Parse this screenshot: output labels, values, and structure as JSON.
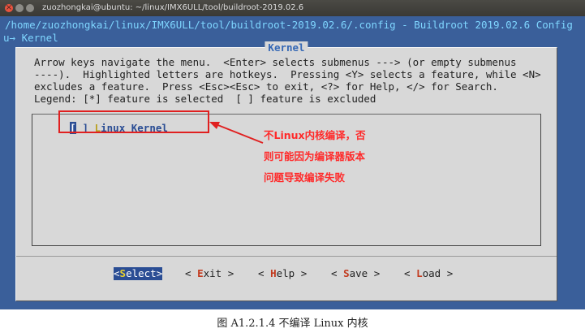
{
  "window": {
    "title": "zuozhongkai@ubuntu: ~/linux/IMX6ULL/tool/buildroot-2019.02.6"
  },
  "terminal": {
    "path_line": "/home/zuozhongkai/linux/IMX6ULL/tool/buildroot-2019.02.6/.config - Buildroot 2019.02.6 Config",
    "menu_line": "u→ Kernel"
  },
  "dialog": {
    "title": "Kernel",
    "help_lines": [
      "Arrow keys navigate the menu.  <Enter> selects submenus ---> (or empty submenus",
      "----).  Highlighted letters are hotkeys.  Pressing <Y> selects a feature, while <N>",
      "excludes a feature.  Press <Esc><Esc> to exit, <?> for Help, </> for Search.",
      "Legend: [*] feature is selected  [ ] feature is excluded"
    ],
    "menu_item": {
      "bracket_open": "[",
      "bracket_close": "]",
      "hotkey": "L",
      "label_rest": "inux Kernel"
    },
    "buttons": {
      "select": {
        "pre": "<",
        "hk": "S",
        "post": "elect>"
      },
      "exit": {
        "pre": "< ",
        "hk": "E",
        "post": "xit >"
      },
      "help": {
        "pre": "< ",
        "hk": "H",
        "post": "elp >"
      },
      "save": {
        "pre": "< ",
        "hk": "S",
        "post": "ave >"
      },
      "load": {
        "pre": "< ",
        "hk": "L",
        "post": "oad >"
      }
    }
  },
  "annotation": {
    "lines": [
      "不Linux内核编译，否",
      "则可能因为编译器版本",
      "问题导致编译失败"
    ],
    "color": "#ff2a2a"
  },
  "caption": "图 A1.2.1.4  不编译 Linux 内核"
}
